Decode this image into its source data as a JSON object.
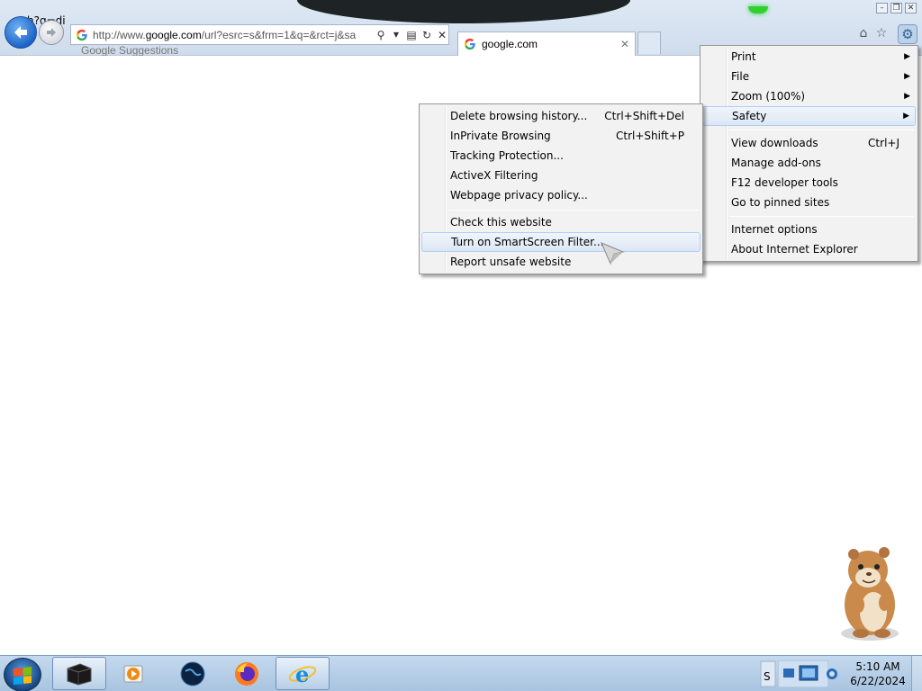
{
  "browser": {
    "ghost_text": "h?q=di",
    "address_url_prefix": "http://www.",
    "address_url_domain": "google.com",
    "address_url_suffix": "/url?esrc=s&frm=1&q=&rct=j&sa",
    "suggestions_label": "Google Suggestions",
    "tab_title": "google.com",
    "colors": {
      "chrome": "#d6e2f0",
      "menu_bg": "#f2f2f2",
      "highlight_border": "#aecff7"
    }
  },
  "tools_menu": {
    "items": [
      {
        "label": "Print",
        "shortcut": "",
        "submenu": true
      },
      {
        "label": "File",
        "shortcut": "",
        "submenu": true
      },
      {
        "label": "Zoom (100%)",
        "shortcut": "",
        "submenu": true
      },
      {
        "label": "Safety",
        "shortcut": "",
        "submenu": true,
        "highlighted": true
      },
      {
        "label": "View downloads",
        "shortcut": "Ctrl+J",
        "submenu": false
      },
      {
        "label": "Manage add-ons",
        "shortcut": "",
        "submenu": false
      },
      {
        "label": "F12 developer tools",
        "shortcut": "",
        "submenu": false
      },
      {
        "label": "Go to pinned sites",
        "shortcut": "",
        "submenu": false
      },
      {
        "label": "Internet options",
        "shortcut": "",
        "submenu": false
      },
      {
        "label": "About Internet Explorer",
        "shortcut": "",
        "submenu": false
      }
    ]
  },
  "safety_menu": {
    "items": [
      {
        "label": "Delete browsing history...",
        "shortcut": "Ctrl+Shift+Del"
      },
      {
        "label": "InPrivate Browsing",
        "shortcut": "Ctrl+Shift+P"
      },
      {
        "label": "Tracking Protection...",
        "shortcut": ""
      },
      {
        "label": "ActiveX Filtering",
        "shortcut": ""
      },
      {
        "label": "Webpage privacy policy...",
        "shortcut": ""
      },
      {
        "label": "Check this website",
        "shortcut": ""
      },
      {
        "label": "Turn on SmartScreen Filter...",
        "shortcut": "",
        "highlighted": true
      },
      {
        "label": "Report unsafe website",
        "shortcut": ""
      }
    ]
  },
  "taskbar": {
    "items": [
      "terminal-icon",
      "media-player-icon",
      "globe-icon",
      "firefox-icon",
      "internet-explorer-icon"
    ],
    "active_item": "internet-explorer-icon",
    "clock_time": "5:10 AM",
    "clock_date": "6/22/2024"
  }
}
